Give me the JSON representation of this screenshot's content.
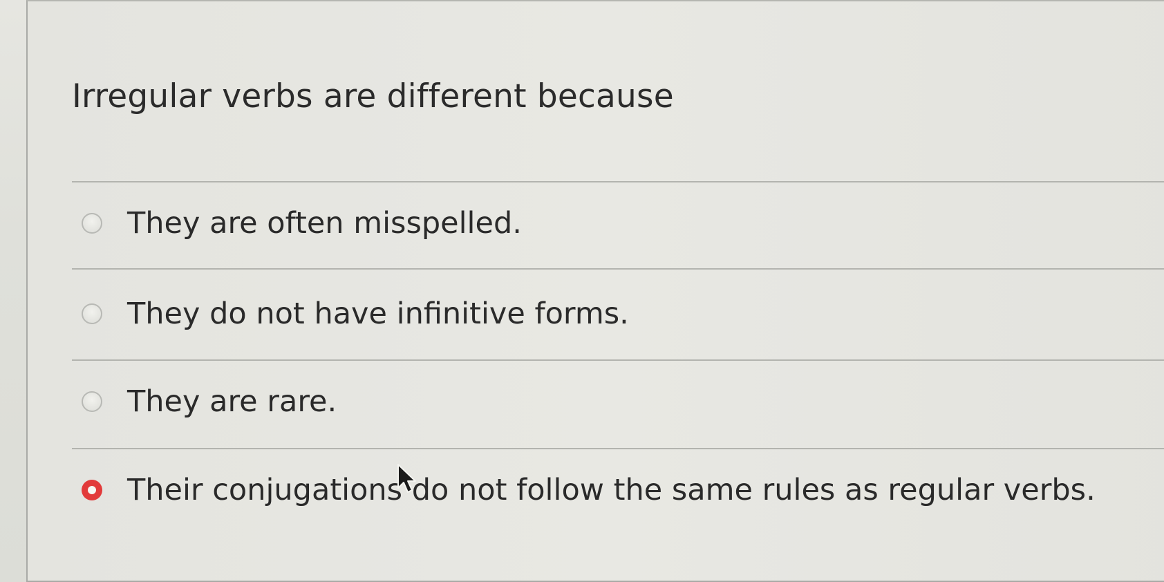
{
  "question": {
    "text": "Irregular verbs are different because"
  },
  "answers": [
    {
      "label": "They are often misspelled.",
      "selected": false
    },
    {
      "label": "They do not have infinitive forms.",
      "selected": false
    },
    {
      "label": "They are rare.",
      "selected": false
    },
    {
      "label": "Their conjugations do not follow the same rules as regular verbs.",
      "selected": true
    }
  ],
  "colors": {
    "selected_radio": "#e23a3a",
    "text": "#2a2a2a",
    "divider": "#b3b4af"
  },
  "icons": {
    "cursor": "mouse-pointer-icon"
  }
}
